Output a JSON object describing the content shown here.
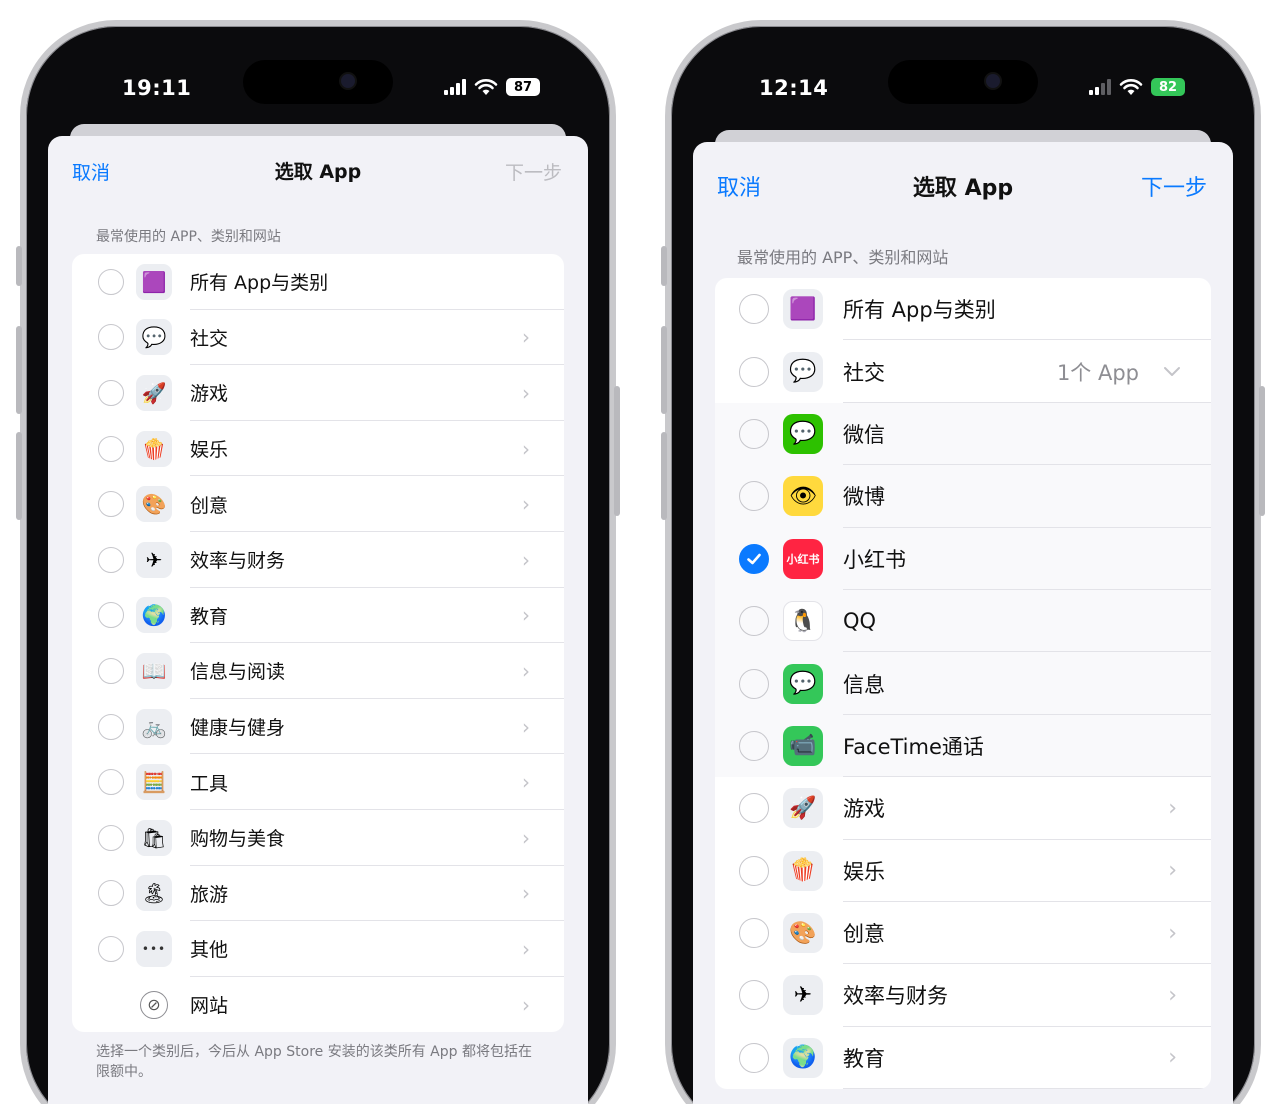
{
  "left": {
    "time": "19:11",
    "battery": "87",
    "nav": {
      "cancel": "取消",
      "title": "选取 App",
      "next": "下一步"
    },
    "section_header": "最常使用的 APP、类别和网站",
    "rows": [
      {
        "label": "所有 App与类别",
        "icon": "stack-icon",
        "glyph": "🟪"
      },
      {
        "label": "社交",
        "icon": "social-bubble-icon",
        "glyph": "💬"
      },
      {
        "label": "游戏",
        "icon": "rocket-icon",
        "glyph": "🚀"
      },
      {
        "label": "娱乐",
        "icon": "popcorn-icon",
        "glyph": "🍿"
      },
      {
        "label": "创意",
        "icon": "palette-icon",
        "glyph": "🎨"
      },
      {
        "label": "效率与财务",
        "icon": "paper-plane-icon",
        "glyph": "✈"
      },
      {
        "label": "教育",
        "icon": "globe-icon",
        "glyph": "🌍"
      },
      {
        "label": "信息与阅读",
        "icon": "book-icon",
        "glyph": "📖"
      },
      {
        "label": "健康与健身",
        "icon": "bicycle-icon",
        "glyph": "🚲"
      },
      {
        "label": "工具",
        "icon": "calculator-icon",
        "glyph": "🧮"
      },
      {
        "label": "购物与美食",
        "icon": "shopping-bag-icon",
        "glyph": "🛍"
      },
      {
        "label": "旅游",
        "icon": "palm-tree-icon",
        "glyph": "🏝"
      },
      {
        "label": "其他",
        "icon": "ellipsis-icon",
        "glyph": "•••"
      },
      {
        "label": "网站",
        "icon": "compass-icon",
        "glyph": "⊘"
      }
    ],
    "footer": "选择一个类别后，今后从 App Store 安装的该类所有 App 都将包括在限额中。"
  },
  "right": {
    "time": "12:14",
    "battery": "82",
    "nav": {
      "cancel": "取消",
      "title": "选取 App",
      "next": "下一步"
    },
    "section_header": "最常使用的 APP、类别和网站",
    "social_detail": "1个 App",
    "rows": [
      {
        "label": "所有 App与类别",
        "icon": "stack-icon",
        "glyph": "🟪"
      },
      {
        "label": "社交",
        "icon": "social-bubble-icon",
        "glyph": "💬"
      },
      {
        "label": "微信",
        "icon": "wechat-icon",
        "glyph": "💬"
      },
      {
        "label": "微博",
        "icon": "weibo-icon",
        "glyph": "👁"
      },
      {
        "label": "小红书",
        "icon": "xiaohongshu-icon",
        "glyph": "小红书"
      },
      {
        "label": "QQ",
        "icon": "qq-penguin-icon",
        "glyph": "🐧"
      },
      {
        "label": "信息",
        "icon": "messages-icon",
        "glyph": "💬"
      },
      {
        "label": "FaceTime通话",
        "icon": "facetime-icon",
        "glyph": "📹"
      },
      {
        "label": "游戏",
        "icon": "rocket-icon",
        "glyph": "🚀"
      },
      {
        "label": "娱乐",
        "icon": "popcorn-icon",
        "glyph": "🍿"
      },
      {
        "label": "创意",
        "icon": "palette-icon",
        "glyph": "🎨"
      },
      {
        "label": "效率与财务",
        "icon": "paper-plane-icon",
        "glyph": "✈"
      },
      {
        "label": "教育",
        "icon": "globe-icon",
        "glyph": "🌍"
      }
    ]
  },
  "colors": {
    "accent": "#0a7aff",
    "background": "#f2f2f7",
    "disabled": "#bcbcc1"
  }
}
